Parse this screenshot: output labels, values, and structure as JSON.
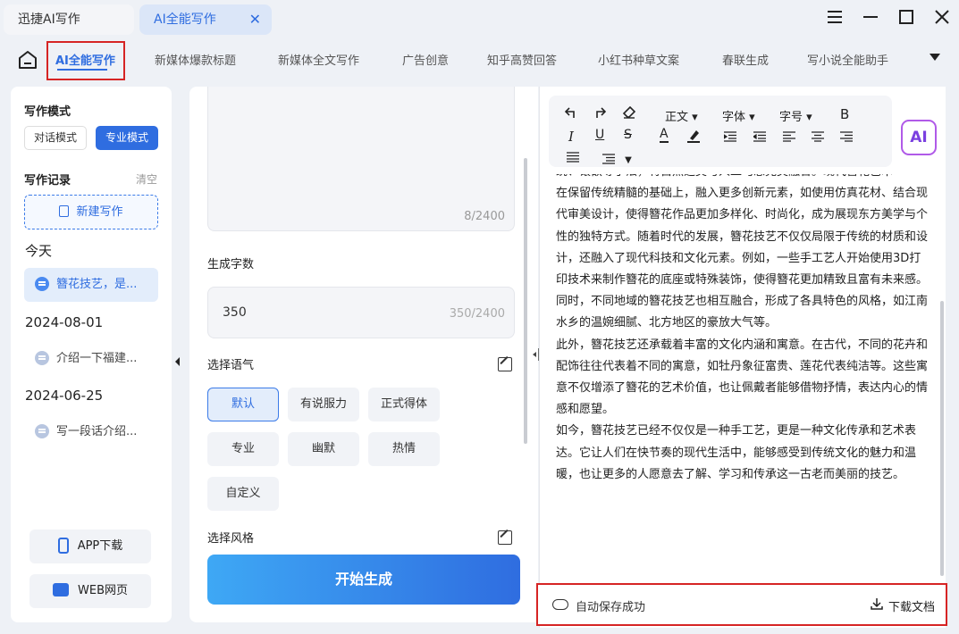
{
  "titlebar": {
    "tabs": [
      {
        "label": "迅捷AI写作"
      },
      {
        "label": "AI全能写作",
        "close": "✕"
      }
    ],
    "window_icons": [
      "menu-icon",
      "minimize-icon",
      "maximize-icon",
      "close-icon"
    ]
  },
  "navbar": {
    "items": [
      {
        "label": "AI全能写作",
        "active": true
      },
      {
        "label": "新媒体爆款标题"
      },
      {
        "label": "新媒体全文写作"
      },
      {
        "label": "广告创意"
      },
      {
        "label": "知乎高赞回答"
      },
      {
        "label": "小红书种草文案"
      },
      {
        "label": "春联生成"
      },
      {
        "label": "写小说全能助手"
      }
    ]
  },
  "left": {
    "mode_title": "写作模式",
    "mode_dialog": "对话模式",
    "mode_pro": "专业模式",
    "record_title": "写作记录",
    "clear": "清空",
    "new_writing": "新建写作",
    "groups": [
      {
        "date": "今天",
        "items": [
          "簪花技艺，是..."
        ]
      },
      {
        "date": "2024-08-01",
        "items": [
          "介绍一下福建..."
        ]
      },
      {
        "date": "2024-06-25",
        "items": [
          "写一段话介绍..."
        ]
      }
    ],
    "app_download": "APP下载",
    "web": "WEB网页"
  },
  "mid": {
    "textarea_count": "8/2400",
    "wordcount_label": "生成字数",
    "wordcount_value": "350",
    "wordcount_counter": "350/2400",
    "tone_label": "选择语气",
    "tones": [
      "默认",
      "有说服力",
      "正式得体",
      "专业",
      "幽默",
      "热情",
      "自定义"
    ],
    "style_label": "选择风格",
    "generate": "开始生成"
  },
  "editor": {
    "toolbar": {
      "paragraph": "正文",
      "font": "字体",
      "size": "字号",
      "bold": "B",
      "italic": "I",
      "underline": "U",
      "strike": "S",
      "textcolor": "A"
    },
    "ai_badge": "AI",
    "clipped_line": "统、镶嵌等手法，将自然之美与人工巧思完美融合。现代簪花艺术",
    "paragraphs": [
      "在保留传统精髓的基础上，融入更多创新元素，如使用仿真花材、结合现代审美设计，使得簪花作品更加多样化、时尚化，成为展现东方美学与个性的独特方式。随着时代的发展，簪花技艺不仅仅局限于传统的材质和设计，还融入了现代科技和文化元素。例如，一些手工艺人开始使用3D打印技术来制作簪花的底座或特殊装饰，使得簪花更加精致且富有未来感。同时，不同地域的簪花技艺也相互融合，形成了各具特色的风格，如江南水乡的温婉细腻、北方地区的豪放大气等。",
      "此外，簪花技艺还承载着丰富的文化内涵和寓意。在古代，不同的花卉和配饰往往代表着不同的寓意，如牡丹象征富贵、莲花代表纯洁等。这些寓意不仅增添了簪花的艺术价值，也让佩戴者能够借物抒情，表达内心的情感和愿望。",
      "如今，簪花技艺已经不仅仅是一种手工艺，更是一种文化传承和艺术表达。它让人们在快节奏的现代生活中，能够感受到传统文化的魅力和温暖，也让更多的人愿意去了解、学习和传承这一古老而美丽的技艺。"
    ],
    "autosave": "自动保存成功",
    "download": "下载文档"
  }
}
